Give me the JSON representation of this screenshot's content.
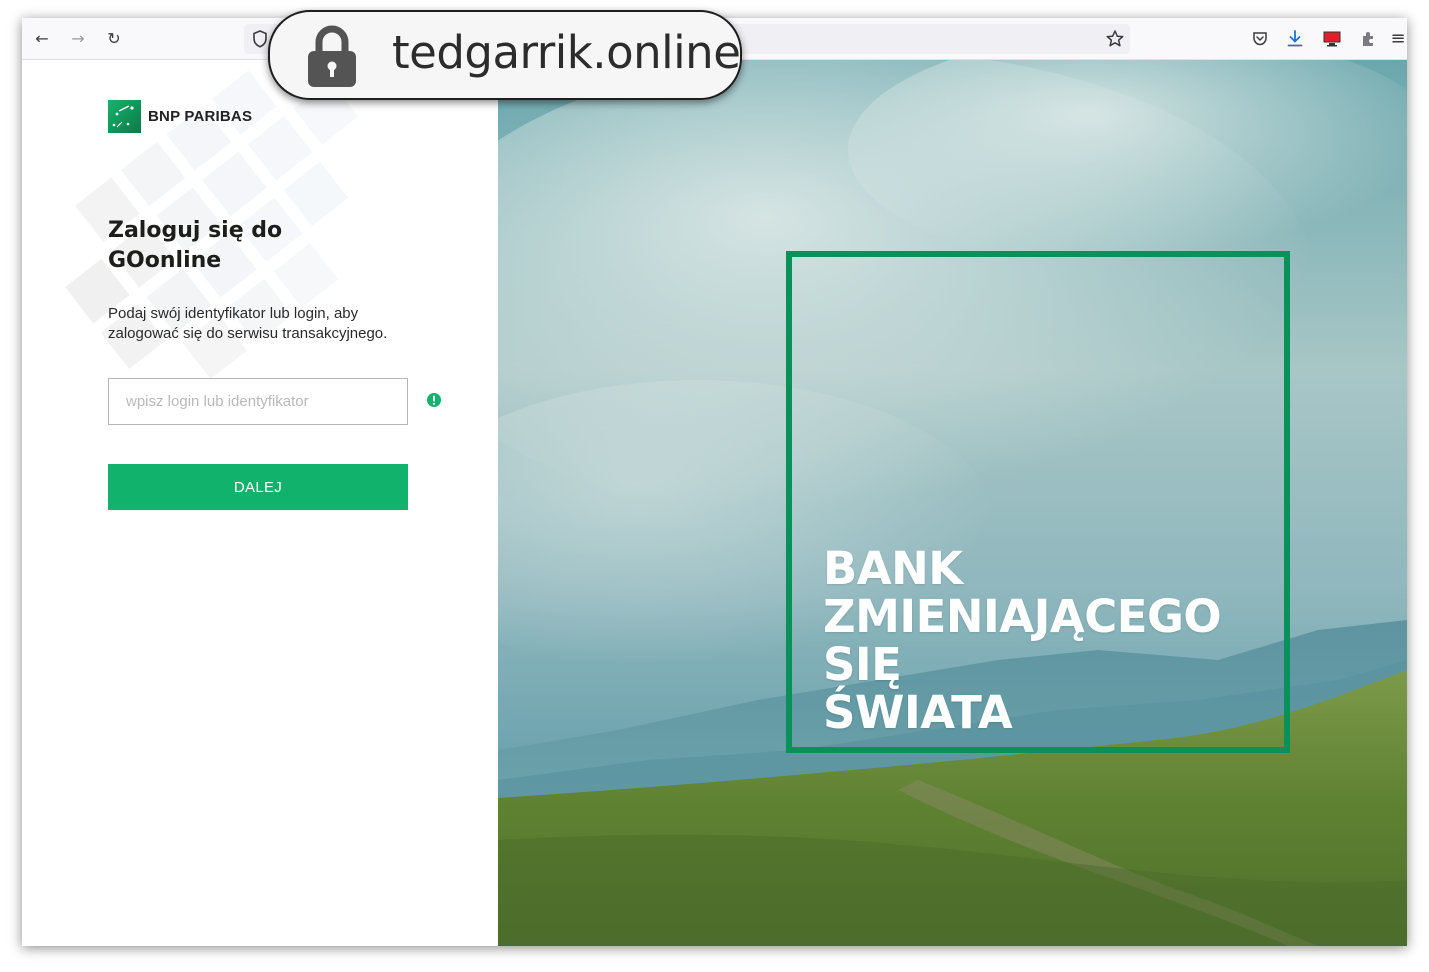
{
  "browser": {
    "back_label": "←",
    "forward_label": "→",
    "reload_label": "↻",
    "menu_label": "≡",
    "url_domain": "tedgarrik.online"
  },
  "bank": {
    "logo_text": "BNP PARIBAS",
    "brand_color": "#0a9059",
    "accent_color": "#11b36c"
  },
  "login": {
    "heading_line1": "Zaloguj się do",
    "heading_line2": "GOonline",
    "description_line1": "Podaj swój identyfikator lub login, aby",
    "description_line2": "zalogować się do serwisu transakcyjnego.",
    "input_value": "",
    "input_placeholder": "wpisz login lub identyfikator",
    "button_label": "DALEJ"
  },
  "hero": {
    "line1": "BANK",
    "line2": "ZMIENIAJĄCEGO",
    "line3": "SIĘ",
    "line4": "ŚWIATA"
  },
  "icons": {
    "shield": "shield-icon",
    "star": "bookmark-star-icon",
    "pocket": "pocket-icon",
    "download": "download-icon",
    "monitor": "screen-share-icon",
    "extension": "extension-icon",
    "lock": "lock-icon",
    "info": "info-icon"
  }
}
